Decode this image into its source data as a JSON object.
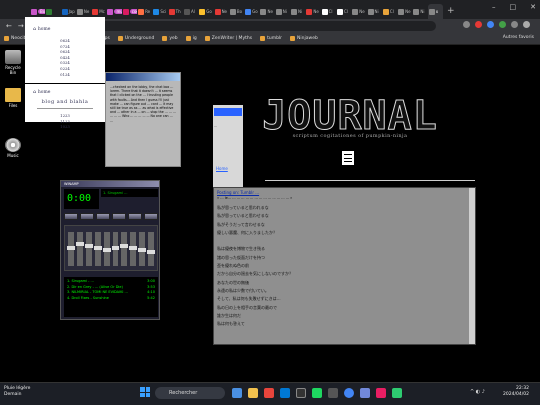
{
  "browser": {
    "tabs": [
      {
        "label": "Bobby",
        "color": "#c957c9",
        "pill": true
      },
      {
        "label": "",
        "color": "#2e7d32"
      },
      {
        "label": "Jap",
        "color": "#1565c0"
      },
      {
        "label": "Ne",
        "color": "#888888"
      },
      {
        "label": "Mc",
        "color": "#e53935"
      },
      {
        "label": "music",
        "color": "#c957c9",
        "pill": true
      },
      {
        "label": "code",
        "color": "#d81b60",
        "pill": true
      },
      {
        "label": "Re",
        "color": "#ff7043"
      },
      {
        "label": "Sci",
        "color": "#1e88e5"
      },
      {
        "label": "Th",
        "color": "#e53935"
      },
      {
        "label": "Al",
        "color": "#555555"
      },
      {
        "label": "Go",
        "color": "#fbc02d"
      },
      {
        "label": "Ne",
        "color": "#e53935"
      },
      {
        "label": "Bo",
        "color": "#888888"
      },
      {
        "label": "Go",
        "color": "#4285f4"
      },
      {
        "label": "Ne",
        "color": "#888888"
      },
      {
        "label": "Ni",
        "color": "#888888"
      },
      {
        "label": "Ni",
        "color": "#888888"
      },
      {
        "label": "Ne",
        "color": "#e53935"
      },
      {
        "label": "Cl",
        "color": "#ffffff"
      },
      {
        "label": "Cl",
        "color": "#ffffff"
      },
      {
        "label": "Ne",
        "color": "#888888"
      },
      {
        "label": "Ni",
        "color": "#888888"
      },
      {
        "label": "Cl",
        "color": "#e8a33a"
      },
      {
        "label": "Ne",
        "color": "#888888"
      },
      {
        "label": "Ni",
        "color": "#888888"
      },
      {
        "label": "x",
        "color": "#888888",
        "active": true
      }
    ],
    "url": "neocities.org/...",
    "bookmarks": [
      "Neocities",
      "mail",
      "Keep",
      "maps",
      "Underground",
      "yeb",
      "ig",
      "ZenWriter | Myths",
      "tumblr",
      "Ninjaweb"
    ],
    "other_bookmarks": "Autres favoris"
  },
  "desktop": {
    "icons": [
      "Recycle Bin",
      "Files",
      "Music"
    ]
  },
  "whitecard": {
    "top_label": "home",
    "numbers_top": [
      "0624",
      "0724",
      "0624",
      "0424",
      "0324",
      "0224",
      "0124"
    ],
    "bottom_label": "home",
    "subtitle": "blog and blahla",
    "numbers_bottom": [
      "1223",
      "1123",
      "1023"
    ]
  },
  "greywin": {
    "text": "...checked on the lobby, the chat box ... lorem. There that it doesn't ... it seems that I clicked on the ... I trusting people with faults... And then I guess I'll just make ... can figure out ... cant ... it may still be true as as ... as what is effective and ... other in a ... on ... stop the ... ... ... ... ... ... Who ... ... ... ... ... No one can ... ..."
  },
  "blog": {
    "logo": "JOURNAL",
    "subtitle": "scriptum cogitationes of pumpkin-ninja",
    "link_text": "Home",
    "post_title": "Posting on: Tumblr ...",
    "post_head": "« ... le... ... ... ... ... ... ... ... ... ... ... ... ... ... »",
    "lines": [
      "私が思っていると思われるな",
      "私が思っていると思わせるな",
      "私がそうだって言わせるな",
      "優しい悪魔、何に入りましたか？",
      "",
      "私は優夜を博物で生き残る",
      "諸の思った仮面だけを持つ",
      "歪を優れぬ色の前",
      "だから自分の過去を気にしないのですか？",
      "あなたの世の無価",
      "永遠の私は少数で付いてい。",
      "そして、私は何も失敗せずにきは…",
      "私の日の上を相手の言葉の最ので",
      "誰か生は何だ",
      "私は何も答えて"
    ]
  },
  "winamp": {
    "title": "WINAMP",
    "time": "0:00",
    "marquee": "1. Sirugami ...",
    "playlist": [
      {
        "title": "1. Sirugami - ...",
        "time": "3:00"
      },
      {
        "title": "2. Dir en Grey - ... (Alive Or Die)",
        "time": "3:53"
      },
      {
        "title": "3. NILMIRIAL - TOMI NE EVIDAIKI ...",
        "time": "4:10"
      },
      {
        "title": "4. Droll Fixes - Sunshine",
        "time": "5:42"
      }
    ]
  },
  "taskbar": {
    "weather_line1": "Pluie légère",
    "weather_line2": "Demain",
    "search_placeholder": "Rechercher",
    "time": "22:32",
    "date": "2024/04/02"
  }
}
